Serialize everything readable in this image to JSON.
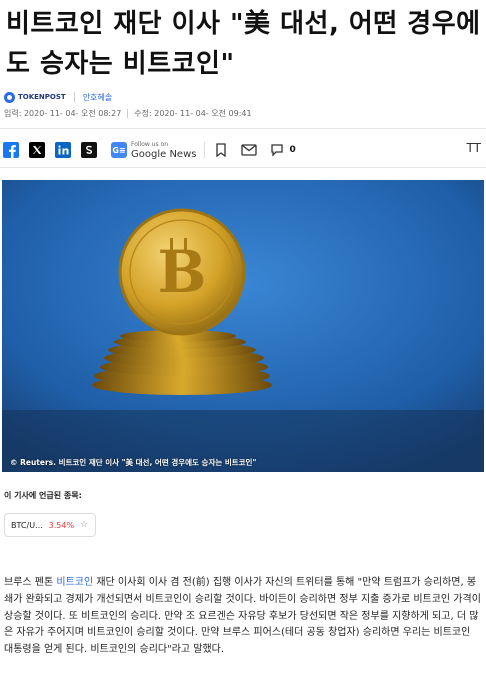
{
  "headline": "비트코인 재단 이사 \"美 대선, 어떤 경우에도 승자는 비트코인\"",
  "source": {
    "logo_text": "TOKENPOST",
    "author": "안호혜솔"
  },
  "dates": {
    "published": "입력: 2020- 11- 04- 오전 08:27",
    "updated": "수정: 2020- 11- 04- 오전 09:41"
  },
  "share": {
    "google_news_small": "Follow us on",
    "google_news_big": "Google News",
    "comment_count": "0",
    "font_size_label": "TT"
  },
  "photo": {
    "caption": "© Reuters. 비트코인 재단 이사 \"美 대선, 어떤 경우에도 승자는 비트코인\""
  },
  "mentioned": {
    "label": "이 기사에 언급된 종목:",
    "tickers": [
      {
        "symbol": "BTC/U...",
        "change": "3.54%"
      }
    ]
  },
  "body": {
    "prefix": "브루스 펜톤 ",
    "link": "비트코인",
    "rest": " 재단 이사회 이사 겸 전(前) 집행 이사가 자신의 트위터를 통해 \"만약 트럼프가 승리하면, 봉쇄가 완화되고 경제가 개선되면서 비트코인이 승리할 것이다. 바이든이 승리하면 정부 지출 증가로 비트코인 가격이 상승할 것이다. 또 비트코인의 승리다. 만약 조 요르겐슨 자유당 후보가 당선되면 작은 정부를 지향하게 되고, 더 많은 자유가 주어지며 비트코인이 승리할 것이다. 만약 브루스 피어스(테더 공동 창업자) 승리하면 우리는 비트코인 대통령을 얻게 된다. 비트코인의 승리다\"라고 말했다."
  },
  "colors": {
    "link": "#2a6ae8",
    "negative": "#e03a3a",
    "photo_bg": "#2a68b5",
    "coin": "#d9a92b"
  }
}
